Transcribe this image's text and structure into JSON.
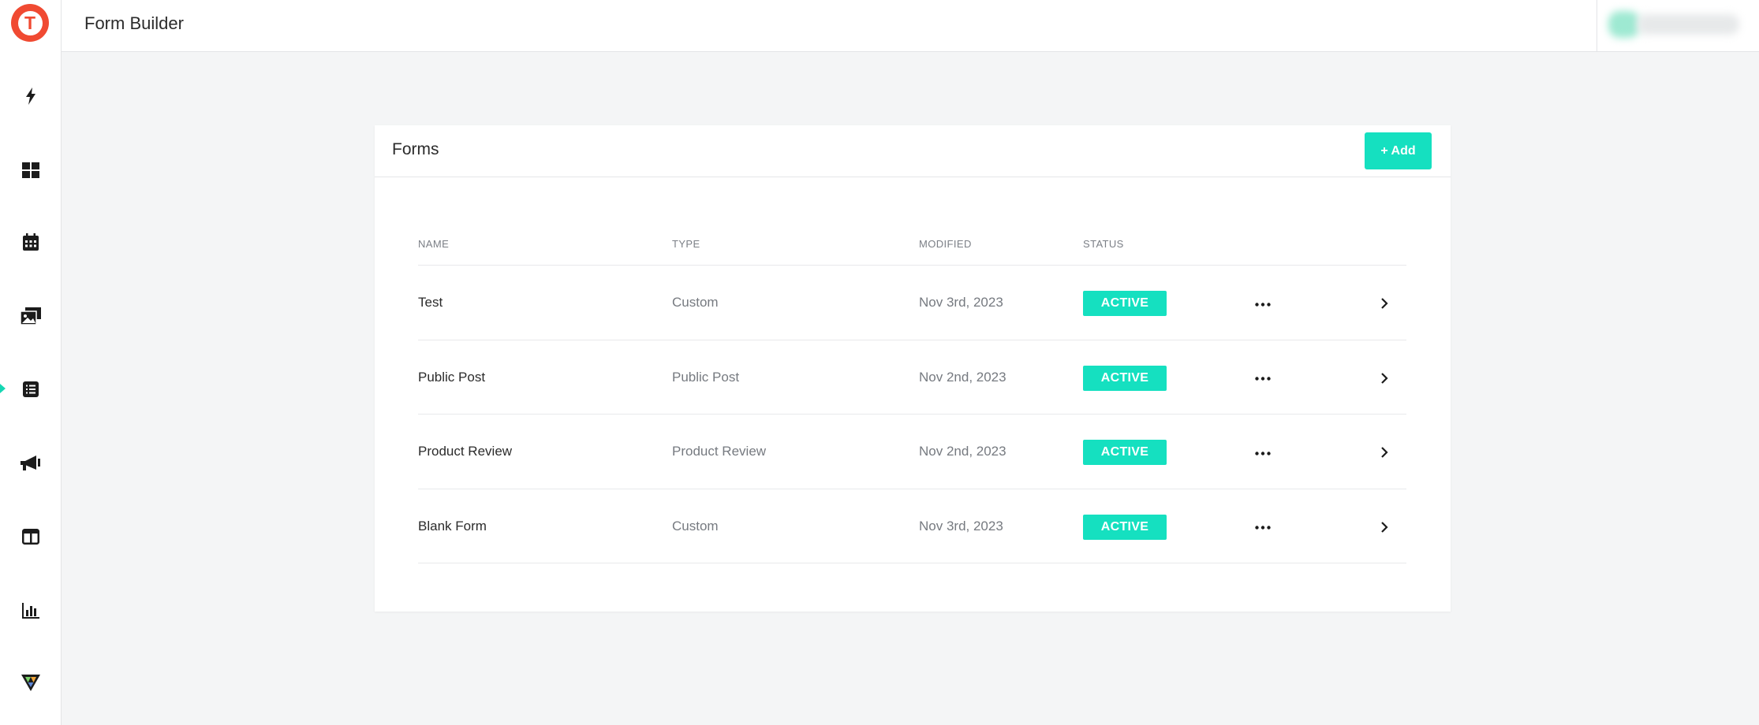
{
  "header": {
    "title": "Form Builder"
  },
  "sidebar": {
    "logo_letter": "T",
    "items": [
      {
        "icon": "bolt-icon"
      },
      {
        "icon": "dashboard-grid-icon"
      },
      {
        "icon": "calendar-icon"
      },
      {
        "icon": "media-gallery-icon"
      },
      {
        "icon": "form-list-icon",
        "active": true
      },
      {
        "icon": "megaphone-icon"
      },
      {
        "icon": "layout-columns-icon"
      },
      {
        "icon": "bar-chart-icon"
      },
      {
        "icon": "triangle-logo-icon"
      }
    ]
  },
  "forms_card": {
    "title": "Forms",
    "add_label": "+ Add",
    "columns": [
      "NAME",
      "TYPE",
      "MODIFIED",
      "STATUS"
    ],
    "rows": [
      {
        "name": "Test",
        "type": "Custom",
        "modified": "Nov 3rd, 2023",
        "status": "ACTIVE"
      },
      {
        "name": "Public Post",
        "type": "Public Post",
        "modified": "Nov 2nd, 2023",
        "status": "ACTIVE"
      },
      {
        "name": "Product Review",
        "type": "Product Review",
        "modified": "Nov 2nd, 2023",
        "status": "ACTIVE"
      },
      {
        "name": "Blank Form",
        "type": "Custom",
        "modified": "Nov 3rd, 2023",
        "status": "ACTIVE"
      }
    ]
  },
  "colors": {
    "accent": "#15e0c0",
    "logo": "#f04a32"
  }
}
